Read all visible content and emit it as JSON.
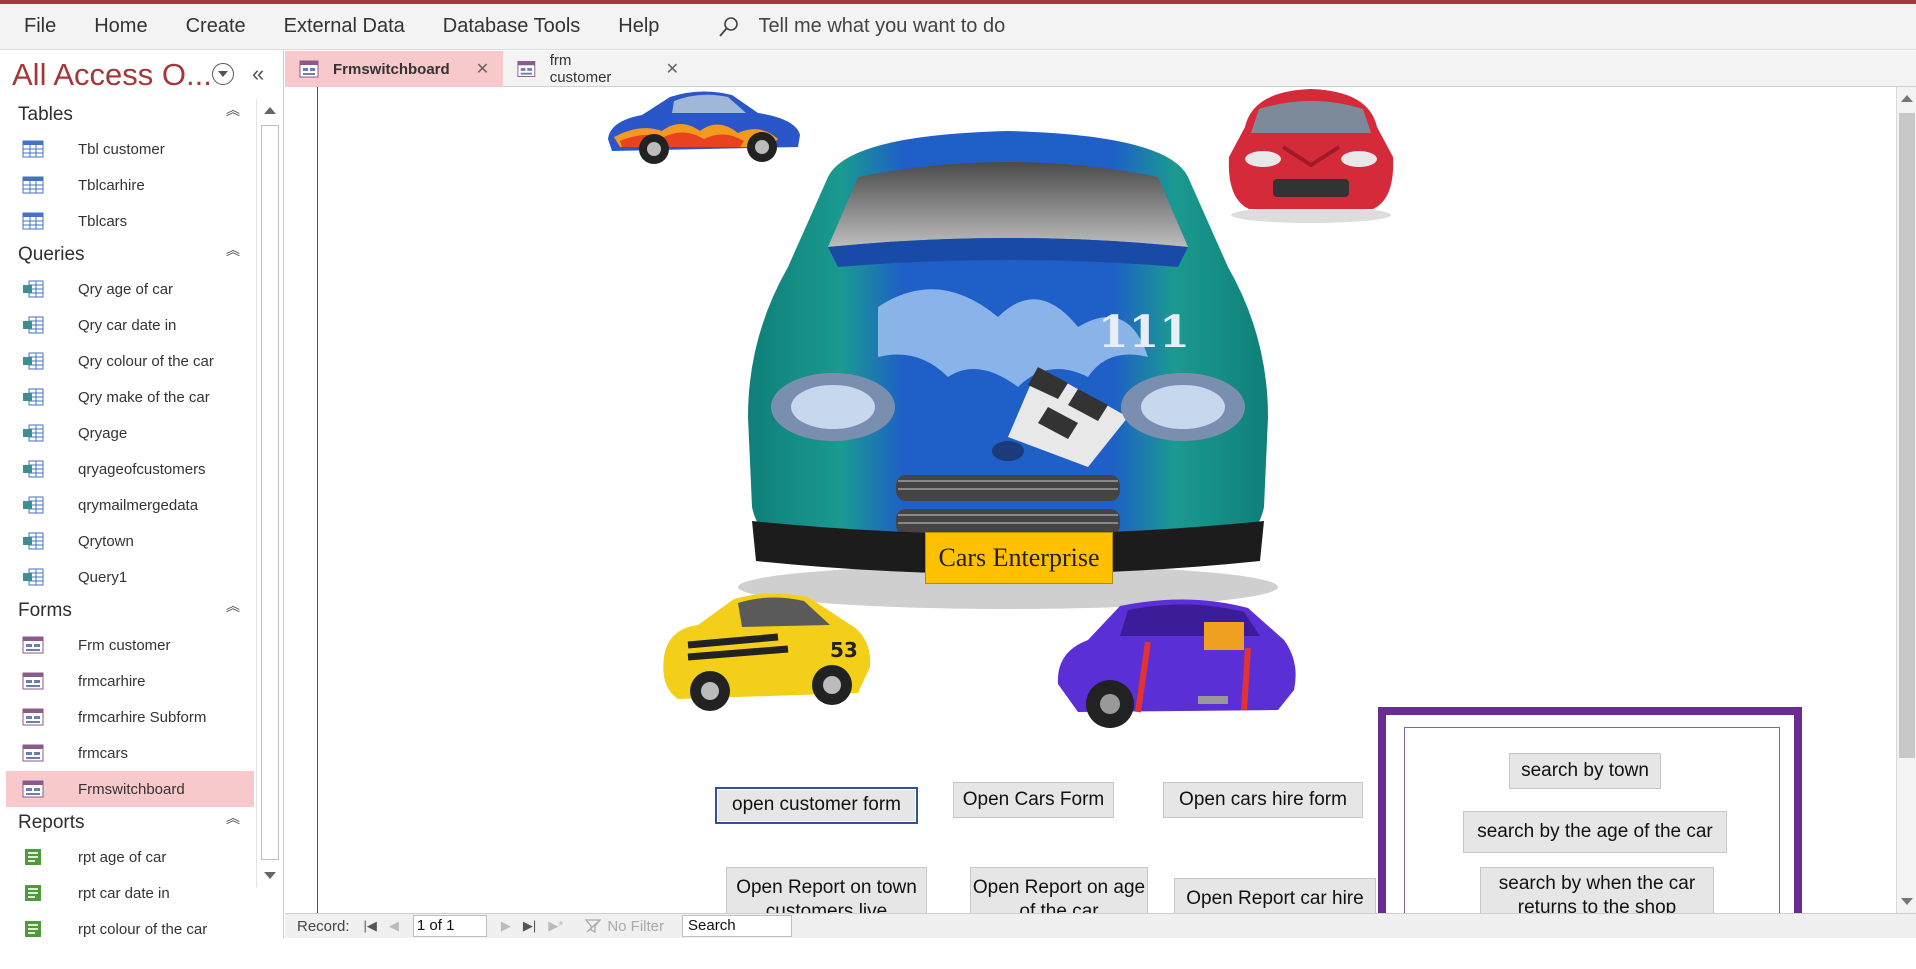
{
  "ribbon": {
    "menus": [
      "File",
      "Home",
      "Create",
      "External Data",
      "Database Tools",
      "Help"
    ],
    "tell_me": "Tell me what you want to do"
  },
  "nav": {
    "title": "All Access O...",
    "groups": [
      {
        "label": "Tables",
        "items": [
          "Tbl customer",
          "Tblcarhire",
          "Tblcars"
        ]
      },
      {
        "label": "Queries",
        "items": [
          "Qry age of car",
          "Qry car date in",
          "Qry colour of the car",
          "Qry make of the car",
          "Qryage",
          "qryageofcustomers",
          "qrymailmergedata",
          "Qrytown",
          "Query1"
        ]
      },
      {
        "label": "Forms",
        "items": [
          "Frm customer",
          "frmcarhire",
          "frmcarhire Subform",
          "frmcars",
          "Frmswitchboard"
        ]
      },
      {
        "label": "Reports",
        "items": [
          "rpt age of car",
          "rpt car date in",
          "rpt colour of the car"
        ]
      }
    ],
    "selected": "Frmswitchboard"
  },
  "tabs": [
    {
      "label": "Frmswitchboard",
      "active": true
    },
    {
      "label": "frm customer",
      "active": false
    }
  ],
  "form": {
    "logo_text": "Cars Enterprise",
    "buttons": {
      "open_customer_form": "open customer form",
      "open_cars_form": "Open Cars Form",
      "open_cars_hire_form": "Open cars hire form",
      "report_town": "Open Report on town customers live",
      "report_age": "Open Report on age of the car",
      "report_car_hire": "Open Report car hire",
      "search_town": "search by town",
      "search_age": "search by the age of the car",
      "search_returns": "search by when the car returns to the shop"
    },
    "frame_color": "#6a2c91"
  },
  "statusbar": {
    "record_label": "Record:",
    "record_value": "1 of 1",
    "no_filter": "No Filter",
    "search": "Search"
  },
  "colors": {
    "accent": "#a4373a",
    "selected_bg": "#f8c9cb",
    "logo_bg": "#ffc000"
  }
}
